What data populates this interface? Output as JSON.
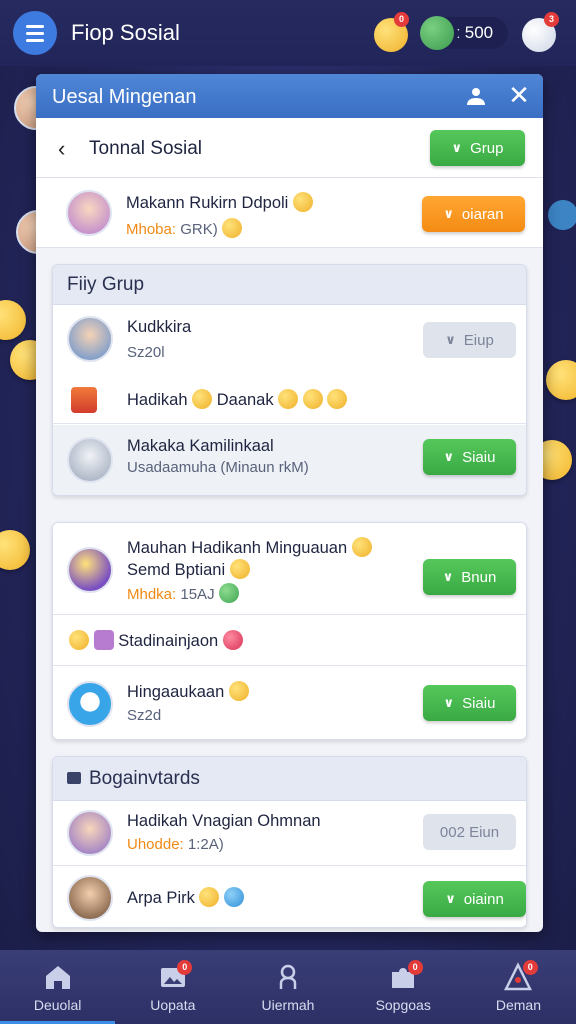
{
  "topbar": {
    "app_title": "Fiop Sosial",
    "coins": "500",
    "coin_prefix": "ː",
    "badges": [
      "0",
      "3"
    ]
  },
  "panel": {
    "title": "Uesal Mingenan",
    "close_label": "✕",
    "subheader": {
      "back_label": "‹",
      "title": "Tonnal Sosial",
      "button_label": "Grup"
    },
    "top_item": {
      "name": "Makann Rukirn Ddpoli",
      "meta_label": "Mhoba:",
      "meta_value": "GRK)",
      "button_label": "oiaran"
    },
    "group_section": {
      "title": "Fiiy Grup",
      "items": [
        {
          "name": "Kudkkira",
          "meta": "Sz20l",
          "button_label": "Eiup"
        },
        {
          "name": "Hadikah",
          "extra": "Daanak"
        },
        {
          "name": "Makaka Kamilinkaal",
          "meta": "Usadaamuha (Minaun rkM)",
          "button_label": "Siaiu"
        }
      ]
    },
    "second_section": {
      "items": [
        {
          "name": "Mauhan Hadikanh Minguauan",
          "line2": "Semd Bptiani",
          "meta_label": "Mhdka:",
          "meta_value": "15AJ",
          "button_label": "Bnun"
        },
        {
          "name": "Stadinainjaon"
        },
        {
          "name": "Hingaaukaan",
          "meta": "Sz2d",
          "button_label": "Siaiu"
        }
      ]
    },
    "leaderboard_section": {
      "title": "Bogainvtards",
      "items": [
        {
          "name": "Hadikah Vnagian Ohmnan",
          "meta_label": "Uhodde:",
          "meta_value": "1:2A)",
          "button_label": "002 Eiun"
        },
        {
          "name": "Arpa Pirk",
          "button_label": "oiainn"
        }
      ]
    }
  },
  "bottomnav": {
    "items": [
      {
        "label": "Deuolal"
      },
      {
        "label": "Uopata",
        "badge": "0"
      },
      {
        "label": "Uiermah"
      },
      {
        "label": "Sopgoas",
        "badge": "0"
      },
      {
        "label": "Deman",
        "badge": "0"
      }
    ]
  },
  "colors": {
    "accent_blue": "#3a6fc4",
    "green_button": "#3aa944",
    "orange_button": "#f48b14",
    "background": "#23265c",
    "badge_red": "#e33a3a"
  }
}
